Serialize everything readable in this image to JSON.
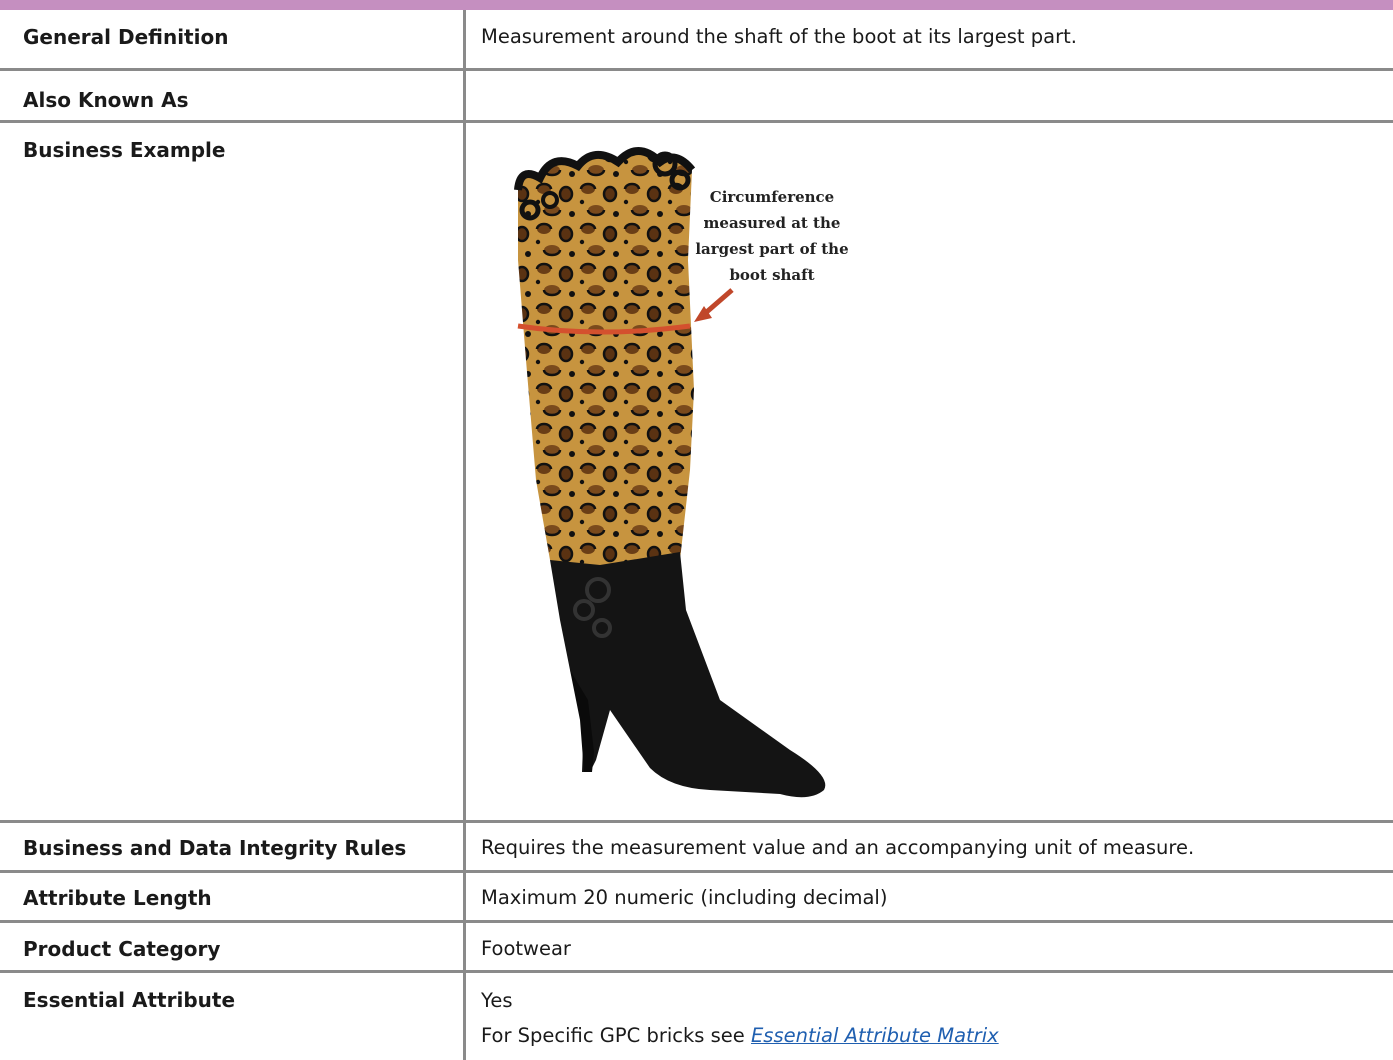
{
  "rows": {
    "general_definition": {
      "label": "General Definition",
      "value": "Measurement around the shaft of the boot at its largest part."
    },
    "also_known_as": {
      "label": "Also Known As",
      "value": ""
    },
    "business_example": {
      "label": "Business Example",
      "image_annotation": [
        "Circumference",
        "measured at the",
        "largest part of the",
        "boot shaft"
      ]
    },
    "business_rules": {
      "label": "Business and Data Integrity Rules",
      "value": "Requires the measurement value and an accompanying unit of measure."
    },
    "attribute_length": {
      "label": "Attribute Length",
      "value": "Maximum 20 numeric (including decimal)"
    },
    "product_category": {
      "label": "Product Category",
      "value": "Footwear"
    },
    "essential_attribute": {
      "label": "Essential Attribute",
      "value": "Yes",
      "note_prefix": "For Specific GPC bricks see ",
      "link_text": "Essential Attribute Matrix"
    }
  },
  "colors": {
    "accent": "#c58fc0",
    "border": "#8a8a8a",
    "link": "#1f5fb0",
    "measure_line": "#d4502e"
  }
}
